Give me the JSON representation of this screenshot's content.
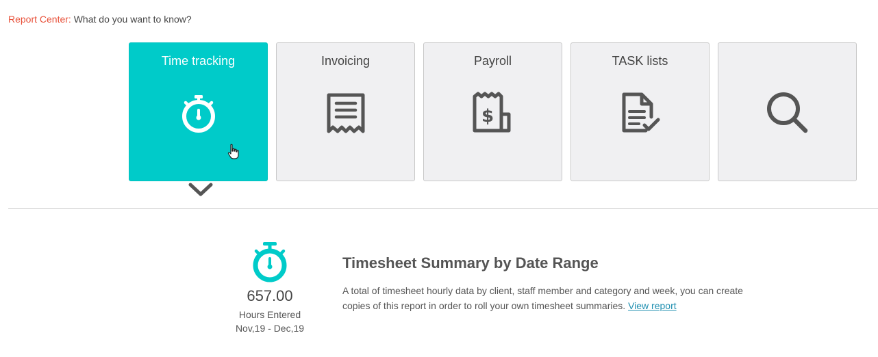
{
  "header": {
    "brand": "Report Center:",
    "question": "What do you want to know?"
  },
  "tiles": [
    {
      "label": "Time tracking",
      "icon": "stopwatch-icon",
      "active": true
    },
    {
      "label": "Invoicing",
      "icon": "receipt-icon",
      "active": false
    },
    {
      "label": "Payroll",
      "icon": "payroll-receipt-icon",
      "active": false
    },
    {
      "label": "TASK lists",
      "icon": "task-file-icon",
      "active": false
    },
    {
      "label": "",
      "icon": "search-icon",
      "active": false
    }
  ],
  "summary": {
    "value": "657.00",
    "label": "Hours Entered",
    "range": "Nov,19 - Dec,19",
    "title": "Timesheet Summary by Date Range",
    "description": "A total of timesheet hourly data by client, staff member and category and week, you can create copies of this report in order to roll your own timesheet summaries.",
    "link": "View report"
  },
  "colors": {
    "accent": "#00cbc9",
    "brand": "#e8513a",
    "link": "#1f8fb0",
    "tile_bg": "#f0f0f2",
    "icon_gray": "#555555"
  }
}
